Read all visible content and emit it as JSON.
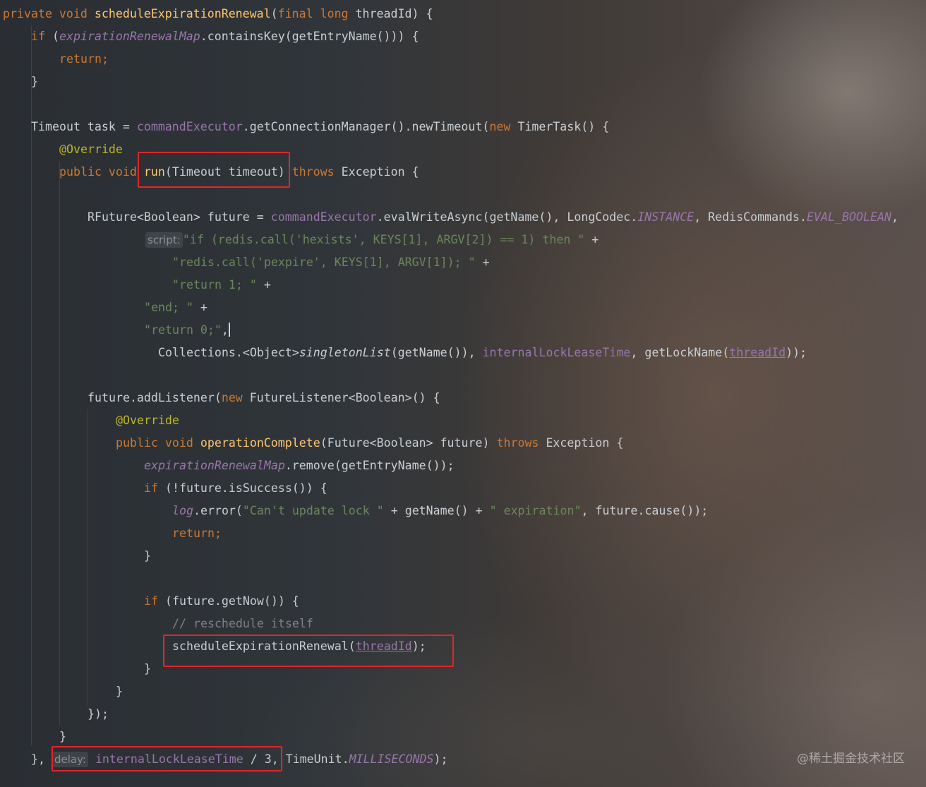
{
  "editor": {
    "lines": {
      "l1": {
        "kw1": "private void ",
        "fn": "scheduleExpirationRenewal",
        "p1": "(",
        "kw2": "final long ",
        "p2": "threadId) {"
      },
      "l2": {
        "kw": "if ",
        "p1": "(",
        "fld": "expirationRenewalMap",
        "p2": ".containsKey(getEntryName())) {"
      },
      "l3": {
        "kw": "return;"
      },
      "l4": {
        "p": "}"
      },
      "l5": {
        "p1": "Timeout task = ",
        "fld": "commandExecutor",
        "p2": ".getConnectionManager().newTimeout(",
        "kw": "new ",
        "p3": "TimerTask() {"
      },
      "l6": {
        "ann": "@Override"
      },
      "l7": {
        "kw1": "public void ",
        "fn": "run",
        "p1": "(Timeout timeout) ",
        "kw2": "throws ",
        "p2": "Exception {"
      },
      "l8": {
        "p1": "RFuture<Boolean> future = ",
        "fld": "commandExecutor",
        "p2": ".evalWriteAsync(getName(), LongCodec.",
        "ifld1": "INSTANCE",
        "p3": ", RedisCommands.",
        "ifld2": "EVAL_BOOLEAN",
        "p4": ","
      },
      "l9": {
        "hint": "script:",
        "str": "\"if (redis.call('hexists', KEYS[1], ARGV[2]) == 1) then \"",
        "p": " +"
      },
      "l10": {
        "str": "\"redis.call('pexpire', KEYS[1], ARGV[1]); \"",
        "p": " +"
      },
      "l11": {
        "str": "\"return 1; \"",
        "p": " +"
      },
      "l12": {
        "str": "\"end; \"",
        "p": " +"
      },
      "l13": {
        "str": "\"return 0;\"",
        "p": ","
      },
      "l14": {
        "p1": "Collections.<Object>",
        "it": "singletonList",
        "p2": "(getName()), ",
        "fld": "internalLockLeaseTime",
        "p3": ", getLockName(",
        "und": "threadId",
        "p4": "));"
      },
      "l15": {
        "p1": "future.addListener(",
        "kw": "new ",
        "p2": "FutureListener<Boolean>() {"
      },
      "l16": {
        "ann": "@Override"
      },
      "l17": {
        "kw1": "public void ",
        "fn": "operationComplete",
        "p1": "(Future<Boolean> future) ",
        "kw2": "throws ",
        "p2": "Exception {"
      },
      "l18": {
        "fld": "expirationRenewalMap",
        "p": ".remove(getEntryName());"
      },
      "l19": {
        "kw": "if ",
        "p": "(!future.isSuccess()) {"
      },
      "l20": {
        "fld": "log",
        "p1": ".error(",
        "str1": "\"Can't update lock \"",
        "p2": " + getName() + ",
        "str2": "\" expiration\"",
        "p3": ", future.cause());"
      },
      "l21": {
        "kw": "return;"
      },
      "l22": {
        "p": "}"
      },
      "l23": {
        "kw": "if ",
        "p": "(future.getNow()) {"
      },
      "l24": {
        "cm": "// reschedule itself"
      },
      "l25": {
        "p1": "scheduleExpirationRenewal(",
        "und": "threadId",
        "p2": ");"
      },
      "l26": {
        "p": "}"
      },
      "l27": {
        "p": "}"
      },
      "l28": {
        "p": "});"
      },
      "l29": {
        "p": "}"
      },
      "l30": {
        "p1": "}, ",
        "hint": "delay:",
        "fld": "internalLockLeaseTime",
        "p2": " / 3, TimeUnit.",
        "ifld": "MILLISECONDS",
        "p3": ");"
      }
    }
  },
  "watermark": "@稀土掘金技术社区",
  "colors": {
    "keyword": "#cc7832",
    "method": "#ffc66d",
    "field": "#9876aa",
    "string": "#6a8759",
    "annotation": "#bbb529",
    "comment": "#808080",
    "highlight_box": "#e0262b"
  }
}
